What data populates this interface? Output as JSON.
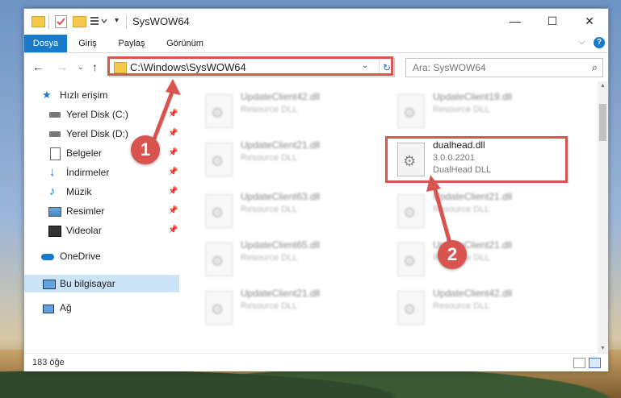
{
  "window": {
    "title": "SysWOW64",
    "controls": {
      "minimize": "—",
      "maximize": "☐",
      "close": "✕"
    }
  },
  "ribbon": {
    "tabs": [
      "Dosya",
      "Giriş",
      "Paylaş",
      "Görünüm"
    ],
    "expand": "⌵",
    "help": "?"
  },
  "nav": {
    "back": "←",
    "forward": "→",
    "recent": "⌄",
    "up": "↑",
    "address": "C:\\Windows\\SysWOW64",
    "address_dropdown": "⌄",
    "refresh": "↻",
    "search_placeholder": "Ara: SysWOW64"
  },
  "navpane": {
    "items": [
      {
        "label": "Hızlı erişim",
        "icon": "star-icon"
      },
      {
        "label": "Yerel Disk (C:)",
        "icon": "drive-icon",
        "pinned": true
      },
      {
        "label": "Yerel Disk (D:)",
        "icon": "drive-icon",
        "pinned": true
      },
      {
        "label": "Belgeler",
        "icon": "documents-icon",
        "pinned": true
      },
      {
        "label": "İndirmeler",
        "icon": "download-icon",
        "pinned": true
      },
      {
        "label": "Müzik",
        "icon": "music-icon",
        "pinned": true
      },
      {
        "label": "Resimler",
        "icon": "pictures-icon",
        "pinned": true
      },
      {
        "label": "Videolar",
        "icon": "videos-icon",
        "pinned": true
      },
      {
        "label": "OneDrive",
        "icon": "cloud-icon"
      },
      {
        "label": "Bu bilgisayar",
        "icon": "computer-icon",
        "selected": true
      },
      {
        "label": "Ağ",
        "icon": "network-icon"
      }
    ]
  },
  "files": [
    {
      "name": "UpdateClient42.dll",
      "type": "Resource DLL",
      "blurred": true
    },
    {
      "name": "UpdateClient19.dll",
      "type": "Resource DLL",
      "blurred": true
    },
    {
      "name": "UpdateClient21.dll",
      "type": "Resource DLL",
      "blurred": true
    },
    {
      "name": "dualhead.dll",
      "version": "3.0.0.2201",
      "type": "DualHead DLL",
      "blurred": false,
      "highlighted": true
    },
    {
      "name": "UpdateClient63.dll",
      "type": "Resource DLL",
      "blurred": true
    },
    {
      "name": "UpdateClient21.dll",
      "type": "Resource DLL",
      "blurred": true
    },
    {
      "name": "UpdateClient65.dll",
      "type": "Resource DLL",
      "blurred": true
    },
    {
      "name": "UpdateClient21.dll",
      "type": "Resource DLL",
      "blurred": true
    },
    {
      "name": "UpdateClient21.dll",
      "type": "Resource DLL",
      "blurred": true
    },
    {
      "name": "UpdateClient42.dll",
      "type": "Resource DLL",
      "blurred": true
    }
  ],
  "status": {
    "count": "183 öğe"
  },
  "callouts": [
    "1",
    "2"
  ],
  "colors": {
    "accent": "#1979ca",
    "highlight": "#d9534f",
    "selection": "#cce4f7"
  }
}
